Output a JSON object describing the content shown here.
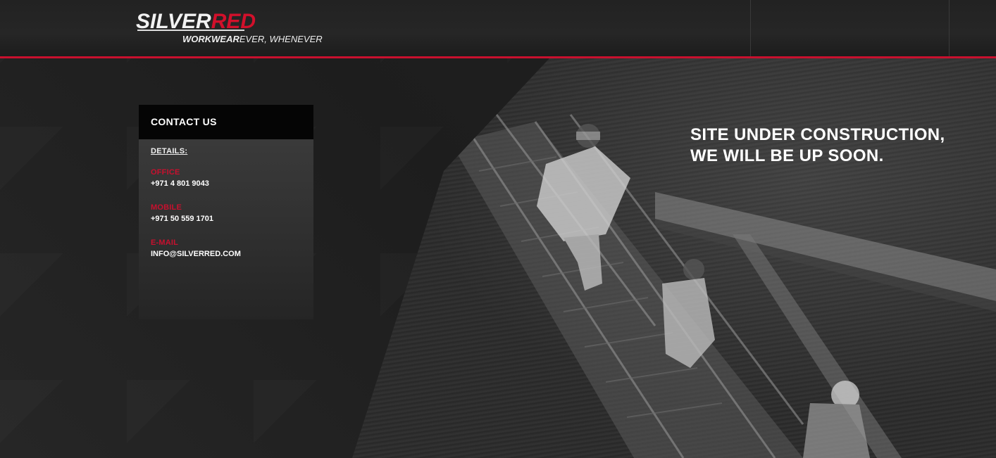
{
  "brand": {
    "logo_silver": "SILVER",
    "logo_red": "RED",
    "tagline_bold": "WORKWEAR",
    "tagline_rest": "EVER, WHENEVER",
    "accent_color": "#c8102e"
  },
  "contact": {
    "title": "CONTACT US",
    "details_label": "DETAILS:",
    "office_label": "OFFICE",
    "office_value": "+971 4 801 9043",
    "mobile_label": "MOBILE",
    "mobile_value": "+971 50 559 1701",
    "email_label": "E-MAIL",
    "email_value": "INFO@SILVERRED.COM"
  },
  "headline": {
    "line1": "SITE UNDER CONSTRUCTION,",
    "line2": "WE WILL BE UP SOON."
  }
}
